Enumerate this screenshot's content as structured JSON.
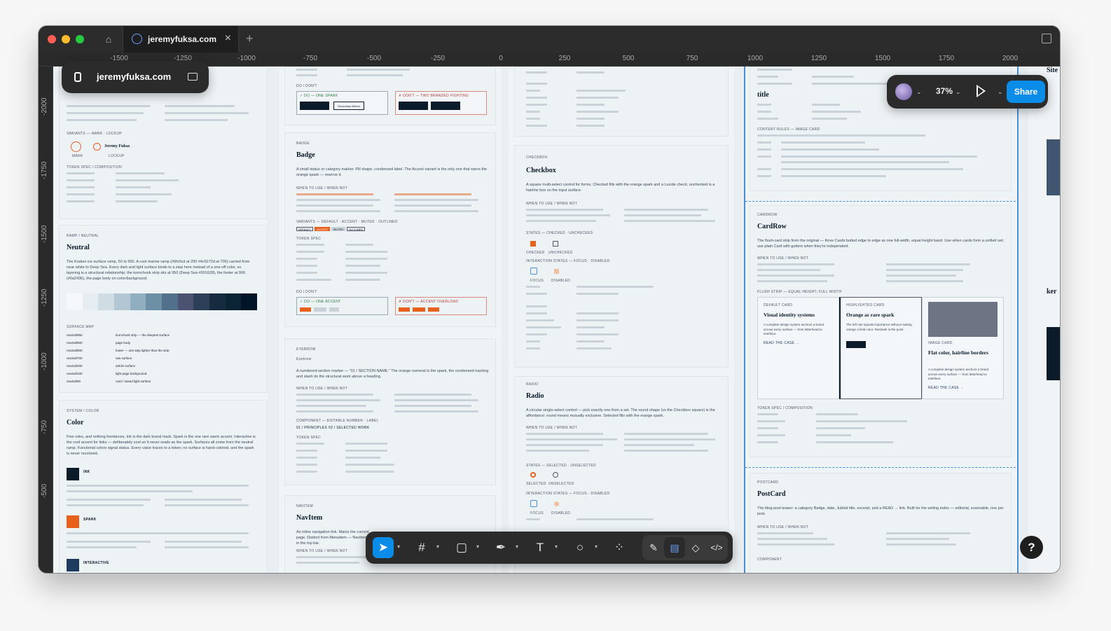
{
  "window": {
    "tab_title": "jeremyfuksa.com",
    "file_name": "jeremyfuksa.com"
  },
  "ruler_h": [
    "-1500",
    "-1250",
    "-1000",
    "-750",
    "-500",
    "-250",
    "0",
    "250",
    "500",
    "750",
    "1000",
    "1250",
    "1500",
    "1750",
    "2000"
  ],
  "ruler_v": [
    "-2000",
    "-1750",
    "-1500",
    "-1250",
    "-1000",
    "-750",
    "-500"
  ],
  "header": {
    "zoom": "37%",
    "share_label": "Share"
  },
  "toolbar": {
    "move_icon": "move-icon",
    "frame_icon": "frame-icon",
    "shape_icon": "shape-icon",
    "pen_icon": "pen-icon",
    "text_icon": "text-icon",
    "comment_icon": "comment-icon",
    "actions_icon": "actions-icon",
    "draw_icon": "draw-icon",
    "design_icon": "design-icon",
    "component_icon": "component-icon",
    "dev_icon": "dev-mode-icon"
  },
  "help_label": "?",
  "colors": {
    "accent": "#0c8ce9",
    "spark": "#e8601c",
    "ink": "#0b1b2a"
  },
  "canvas": {
    "col1": {
      "lockup_variants_label": "VARIANTS — MARK · LOCKUP",
      "mark_label": "MARK",
      "lockup_label": "LOCKUP",
      "lockup_name": "Jeremy Fuksa",
      "token_spec": "TOKEN SPEC / COMPOSITION",
      "neutral_kicker": "RAMP / NEUTRAL",
      "neutral_title": "Neutral",
      "neutral_desc": "The Kraken ice surface ramp, 50 to 950. A cool marine ramp (#0fc0cd at 200 #4c5272d at 700) carried from near-white to Deep Sea. Every dark and light surface binds to a step here instead of a one-off color, so layering is a structural relationship: the kornchunk strip sits at 950 (Deep Sea #001628), the footer at 900 (#0a2436), the page body on color/background.",
      "surface_map": "SURFACE MAP",
      "neutral_rows": [
        "neutral/950",
        "neutral/900",
        "neutral/800",
        "neutral/700",
        "neutral/200",
        "neutral/100",
        "neutral/50"
      ],
      "neutral_vals": [
        "kornchunk strip — the deepest surface",
        "page body",
        "footer — one step lighter than the strip",
        "raw surface",
        "article surface",
        "light page background",
        "card / raised light surface"
      ],
      "color_kicker": "SYSTEM / COLOR",
      "color_title": "Color",
      "color_desc": "Five roles, and nothing freelances. Ink is the dark brand mark. Spark is the one rare warm accent. Interactive is the cool accent for links — deliberately cool so it never reads as the spark. Surfaces all come from the neutral ramp. Functional colors signal status. Every value traces to a token; no surface is hand-colored, and the spark is never recolored.",
      "ink_label": "INK",
      "spark_label": "SPARK",
      "interactive_label": "INTERACTIVE"
    },
    "col2": {
      "badge_kicker": "BADGE",
      "badge_title": "Badge",
      "badge_desc": "A small status or category marker. Pill shape, condensed label. The Accent variant is the only one that earns the orange spark — reserve it.",
      "when": "WHEN TO USE / WHEN NOT",
      "variants": "VARIANTS — DEFAULT · ACCENT · MUTED · OUTLINED",
      "tags": [
        "DEFAULT",
        "ACCENT",
        "MUTED",
        "OUTLINED"
      ],
      "token": "TOKEN SPEC",
      "do_dont": "DO / DON'T",
      "do_label": "✓ DO — ONE ACCENT",
      "dont_label": "✗ DON'T — ACCENT OVERLOAD",
      "do_label_top": "✓ DO — ONE SPARK",
      "dont_label_top": "✗ DON'T — TWO BRANDED FIGHTING",
      "secondary_btn": "Secondary Button",
      "eyebrow_kicker": "EYEBROW",
      "eyebrow_title": "Eyebrow",
      "eyebrow_desc": "A numbered section marker — \"01 / SECTION NAME.\" The orange numeral is the spark, the condensed tracking and slash do the structural work above a heading.",
      "component_editable": "COMPONENT — EDITABLE NUMBER · LABEL",
      "principles": "01 / PRINCIPLES",
      "selected": "02 / SELECTED WORK",
      "navitem_kicker": "NAVITEM",
      "navitem_title": "NavItem",
      "navitem_desc": "An inline navigation link. Marks the current page. Distinct from MenuItem — NavItem is in the top bar."
    },
    "col3": {
      "checkbox_kicker": "CHECKBOX",
      "checkbox_title": "Checkbox",
      "checkbox_desc": "A square multi-select control for forms. Checked fills with the orange spark and a Lucide check; unchecked is a hairline box on the input surface.",
      "states": "STATES — CHECKED · UNCHECKED",
      "checked": "CHECKED",
      "unchecked": "UNCHECKED",
      "interaction": "INTERACTION STATES — FOCUS · DISABLED",
      "focus": "FOCUS",
      "disabled": "DISABLED",
      "radio_kicker": "RADIO",
      "radio_title": "Radio",
      "radio_desc": "A circular single-select control — pick exactly one from a set. The round shape (vs the Checkbox square) is the affordance: round means mutually exclusive. Selected fills with the orange spark.",
      "radio_states": "STATES — SELECTED · UNSELECTED",
      "selected": "SELECTED",
      "unselected": "UNSELECTED"
    },
    "col4": {
      "title_label": "title",
      "content_rules": "CONTENT RULES — image card",
      "cardrow_kicker": "CARDROW",
      "cardrow_title": "CardRow",
      "cardrow_desc": "The flush-card strip from the original — three Cards butted edge to edge as one full-width, equal-height band. Use when cards form a unified set; use plain Card with gutters when they're independent.",
      "flush": "FLUSH STRIP — EQUAL HEIGHT, FULL WIDTH",
      "card1_kicker": "DEFAULT CARD",
      "card1_title": "Visual identity systems",
      "card1_body": "A complete design system anchors a brand across every surface — from letterhead to interface.",
      "read_case": "READ THE CASE →",
      "card2_kicker": "HIGHLIGHTED CARD",
      "card2_title": "Orange as rare spark",
      "card2_body": "The left rule signals importance without making orange a field color. Restraint is the point.",
      "card3_kicker": "IMAGE CARD",
      "card3_title": "Flat color, hairline borders",
      "card3_body": "A complete design system anchors a brand across every surface — from letterhead to interface.",
      "postcard_kicker": "POSTCARD",
      "postcard_title": "PostCard",
      "postcard_desc": "The blog-post teaser: a category Badge, date, Jubilat title, excerpt, and a READ → link. Built for the writing index — editorial, scannable, one per post.",
      "component": "COMPONENT"
    },
    "col5": {
      "title_a": "Site",
      "title_b": "ker"
    }
  }
}
